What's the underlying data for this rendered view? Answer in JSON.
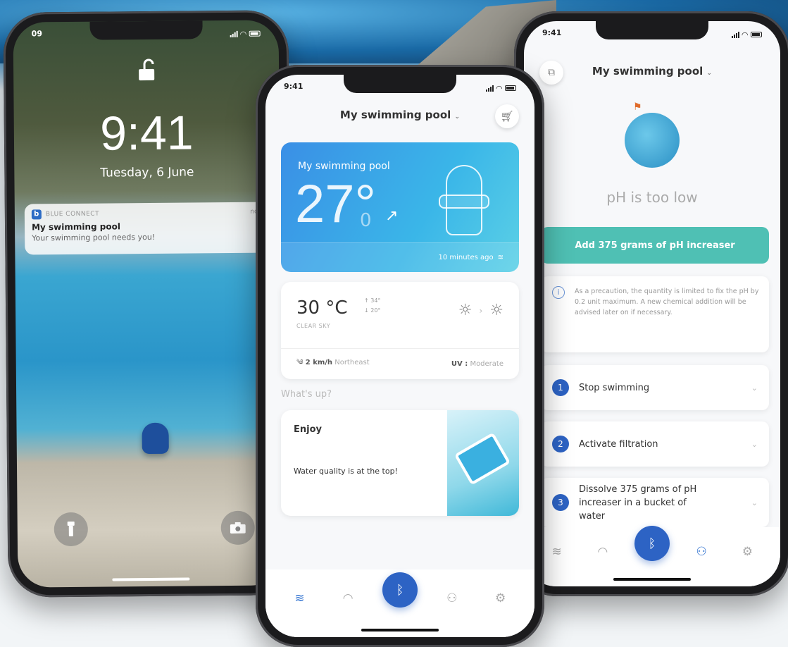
{
  "lock_screen": {
    "status_time": "09",
    "time": "9:41",
    "date": "Tuesday, 6 June",
    "notification": {
      "app_name": "BLUE CONNECT",
      "app_badge": "b",
      "time": "now",
      "title": "My swimming pool",
      "body": "Your swimming pool needs you!"
    }
  },
  "dashboard": {
    "status_time": "9:41",
    "header_title": "My swimming pool",
    "pool_card": {
      "title": "My swimming pool",
      "temperature": "27°",
      "decimal": "0",
      "updated": "10 minutes ago"
    },
    "weather": {
      "temperature": "30 °C",
      "high": "↑ 34°",
      "low": "↓ 20°",
      "condition": "CLEAR SKY",
      "wind_value": "2 km/h",
      "wind_dir": "Northeast",
      "uv_label": "UV :",
      "uv_value": "Moderate"
    },
    "section_label": "What's up?",
    "tip": {
      "title": "Enjoy",
      "body": "Water quality is at the top!"
    }
  },
  "ph_screen": {
    "status_time": "9:41",
    "header_title": "My swimming pool",
    "title": "pH is too low",
    "action_label": "Add 375 grams of pH increaser",
    "info_text": "As a precaution, the quantity is limited to fix the pH by 0.2 unit maximum. A new chemical addition will be advised later on if necessary.",
    "steps": [
      {
        "num": "1",
        "label": "Stop swimming"
      },
      {
        "num": "2",
        "label": "Activate filtration"
      },
      {
        "num": "3",
        "label": "Dissolve 375 grams of pH increaser in a bucket of water"
      }
    ]
  },
  "icons": [
    "lock-open-icon",
    "flashlight-icon",
    "camera-icon",
    "cart-icon",
    "copy-icon",
    "chevron-down-icon",
    "sun-icon",
    "wind-icon",
    "bluetooth-icon",
    "pool-icon",
    "gauge-icon",
    "people-icon",
    "gear-icon",
    "info-icon",
    "trend-up-icon",
    "wave-icon"
  ],
  "colors": {
    "primary": "#2d63c4",
    "accent_teal": "#4fc0b4",
    "card_gradient_start": "#3a8fe6",
    "card_gradient_end": "#5bd0e6"
  }
}
